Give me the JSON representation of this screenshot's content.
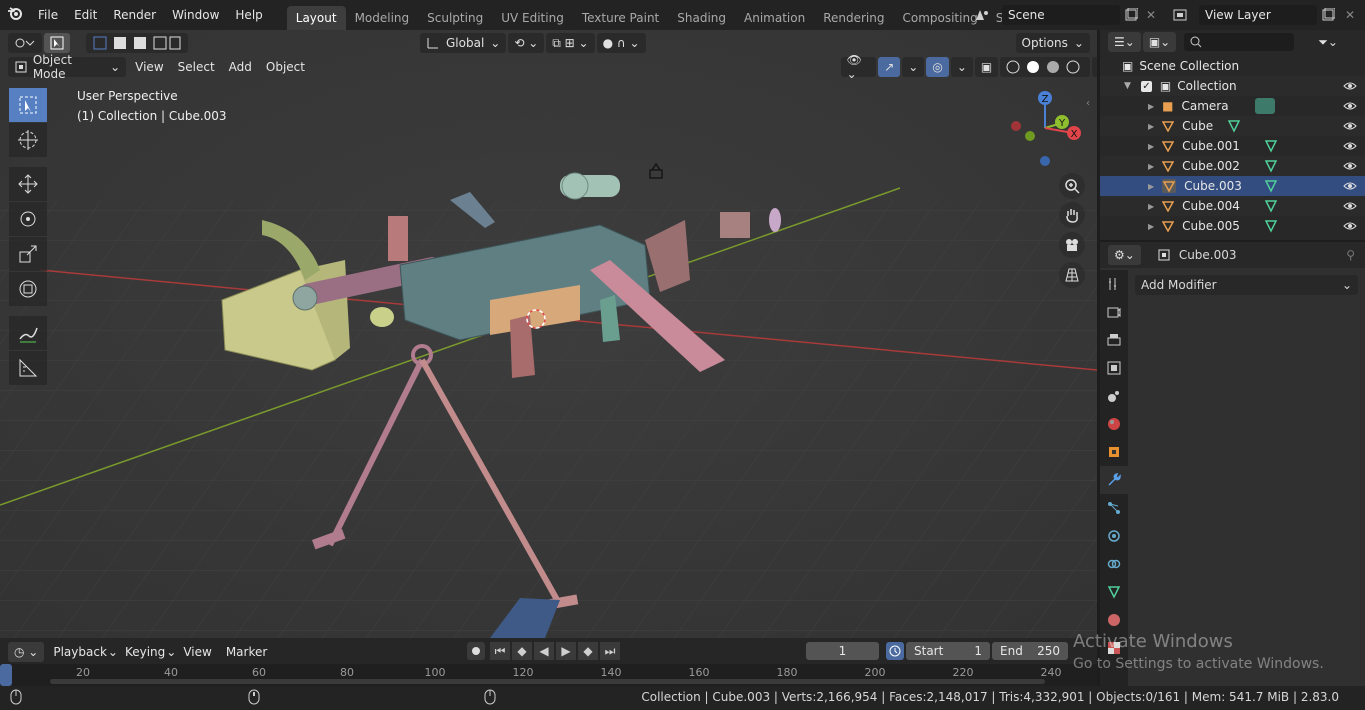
{
  "topbar": {
    "menus": [
      "File",
      "Edit",
      "Render",
      "Window",
      "Help"
    ],
    "workspaces": [
      "Layout",
      "Modeling",
      "Sculpting",
      "UV Editing",
      "Texture Paint",
      "Shading",
      "Animation",
      "Rendering",
      "Compositing",
      "Scripting"
    ],
    "active_workspace": "Layout",
    "scene": "Scene",
    "view_layer": "View Layer"
  },
  "viewport": {
    "transform_orientation": "Global",
    "options_label": "Options",
    "mode": "Object Mode",
    "menus": [
      "View",
      "Select",
      "Add",
      "Object"
    ],
    "perspective_label": "User Perspective",
    "context_label": "(1) Collection | Cube.003",
    "gizmo_axes": [
      "Z",
      "Y",
      "X"
    ]
  },
  "timeline": {
    "menus": [
      "Playback",
      "Keying",
      "View",
      "Marker"
    ],
    "current_frame": "1",
    "start_label": "Start",
    "start": "1",
    "end_label": "End",
    "end": "250",
    "ticks": [
      "20",
      "40",
      "60",
      "80",
      "100",
      "120",
      "140",
      "160",
      "180",
      "200",
      "220",
      "240"
    ]
  },
  "outliner": {
    "root": "Scene Collection",
    "collection": "Collection",
    "objects": [
      "Camera",
      "Cube",
      "Cube.001",
      "Cube.002",
      "Cube.003",
      "Cube.004",
      "Cube.005"
    ],
    "selected": "Cube.003"
  },
  "properties": {
    "object_name": "Cube.003",
    "add_modifier_label": "Add Modifier"
  },
  "statusbar": {
    "text": "Collection | Cube.003 | Verts:2,166,954 | Faces:2,148,017 | Tris:4,332,901 | Objects:0/161 | Mem: 541.7 MiB | 2.83.0"
  },
  "watermark": {
    "title": "Activate Windows",
    "subtitle": "Go to Settings to activate Windows."
  },
  "colors": {
    "accent": "#5680c2",
    "viewport_bg": "#3a3a3a",
    "x_axis": "#e0454a",
    "y_axis": "#8fbf2f",
    "z_axis": "#4a80d6",
    "selected_row": "#334d80"
  }
}
